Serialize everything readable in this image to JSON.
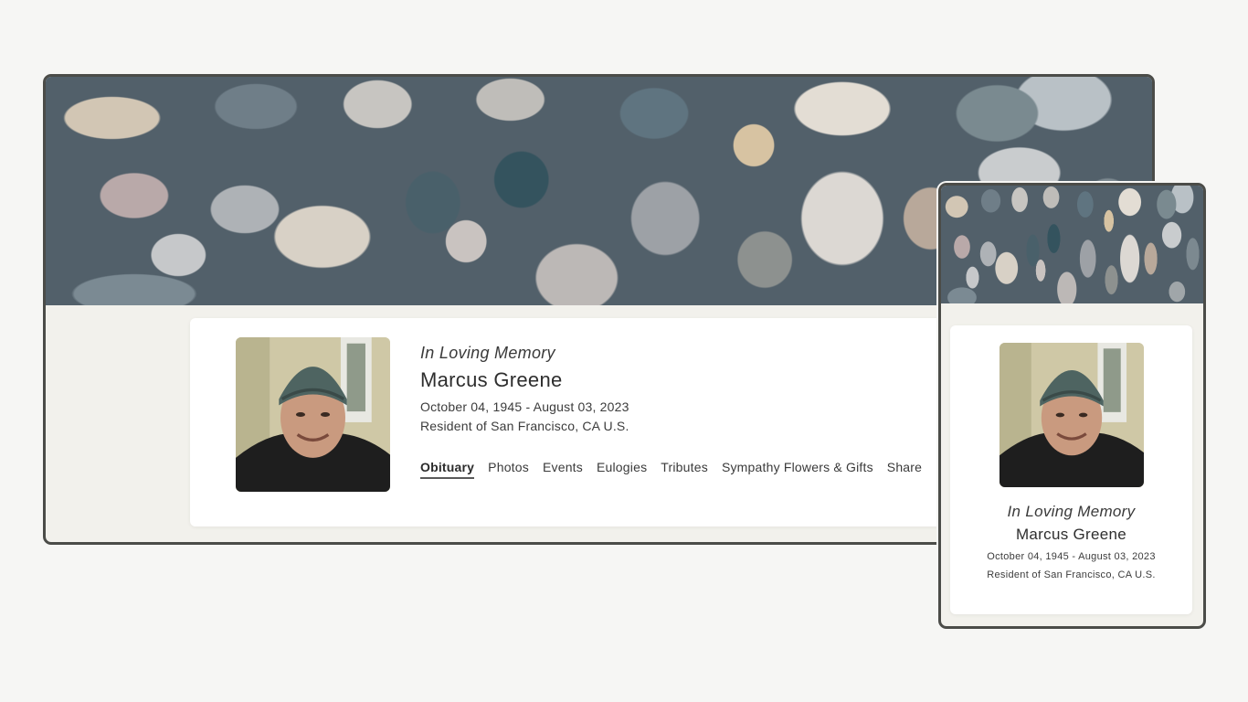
{
  "desktop": {
    "memory_label": "In Loving Memory",
    "name": "Marcus Greene",
    "dates": "October 04, 1945 - August 03, 2023",
    "resident": "Resident of San Francisco, CA U.S.",
    "nav": [
      {
        "label": "Obituary",
        "active": true
      },
      {
        "label": "Photos",
        "active": false
      },
      {
        "label": "Events",
        "active": false
      },
      {
        "label": "Eulogies",
        "active": false
      },
      {
        "label": "Tributes",
        "active": false
      },
      {
        "label": "Sympathy Flowers & Gifts",
        "active": false
      },
      {
        "label": "Share",
        "active": false
      }
    ]
  },
  "mobile": {
    "memory_label": "In Loving Memory",
    "name": "Marcus Greene",
    "dates": "October 04, 1945 - August 03, 2023",
    "resident": "Resident of San Francisco, CA U.S."
  },
  "colors": {
    "background": "#f6f6f4",
    "frame_border": "#4b4c48",
    "card": "#ffffff",
    "panel": "#f2f1ec"
  }
}
